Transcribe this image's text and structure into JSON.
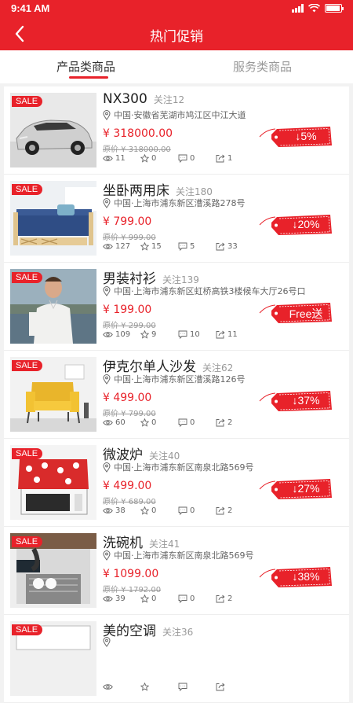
{
  "status": {
    "time": "9:41 AM"
  },
  "nav": {
    "title": "热门促销"
  },
  "tabs": [
    {
      "label": "产品类商品"
    },
    {
      "label": "服务类商品"
    }
  ],
  "sale_label": "SALE",
  "items": [
    {
      "name": "NX300",
      "follow": "关注12",
      "address": "中国·安徽省芜湖市鸠江区中江大道",
      "price": "¥ 318000.00",
      "original": "原价 ¥ 318000.00",
      "views": "11",
      "stars": "0",
      "comments": "0",
      "shares": "1",
      "tag": "↓5%",
      "photo": "car"
    },
    {
      "name": "坐卧两用床",
      "follow": "关注180",
      "address": "中国·上海市浦东新区漕溪路278号",
      "price": "¥ 799.00",
      "original": "原价 ¥ 999.00",
      "views": "127",
      "stars": "15",
      "comments": "5",
      "shares": "33",
      "tag": "↓20%",
      "photo": "bed"
    },
    {
      "name": "男装衬衫",
      "follow": "关注139",
      "address": "中国·上海市浦东新区虹桥高铁3楼候车大厅26号口",
      "price": "¥ 199.00",
      "original": "原价 ¥ 299.00",
      "views": "109",
      "stars": "9",
      "comments": "10",
      "shares": "11",
      "tag": "Free送",
      "photo": "shirt"
    },
    {
      "name": "伊克尔单人沙发",
      "follow": "关注62",
      "address": "中国·上海市浦东新区漕溪路126号",
      "price": "¥ 499.00",
      "original": "原价 ¥ 799.00",
      "views": "60",
      "stars": "0",
      "comments": "0",
      "shares": "2",
      "tag": "↓37%",
      "photo": "sofa"
    },
    {
      "name": "微波炉",
      "follow": "关注40",
      "address": "中国·上海市浦东新区南泉北路569号",
      "price": "¥ 499.00",
      "original": "原价 ¥ 689.00",
      "views": "38",
      "stars": "0",
      "comments": "0",
      "shares": "2",
      "tag": "↓27%",
      "photo": "microwave"
    },
    {
      "name": "洗碗机",
      "follow": "关注41",
      "address": "中国·上海市浦东新区南泉北路569号",
      "price": "¥ 1099.00",
      "original": "原价 ¥ 1792.00",
      "views": "39",
      "stars": "0",
      "comments": "0",
      "shares": "2",
      "tag": "↓38%",
      "photo": "dishwasher"
    },
    {
      "name": "美的空调",
      "follow": "关注36",
      "address": "",
      "price": "",
      "original": "",
      "views": "",
      "stars": "",
      "comments": "",
      "shares": "",
      "tag": "",
      "photo": "ac"
    }
  ],
  "colors": {
    "accent": "#e8222a",
    "tag": "#e8222a"
  }
}
